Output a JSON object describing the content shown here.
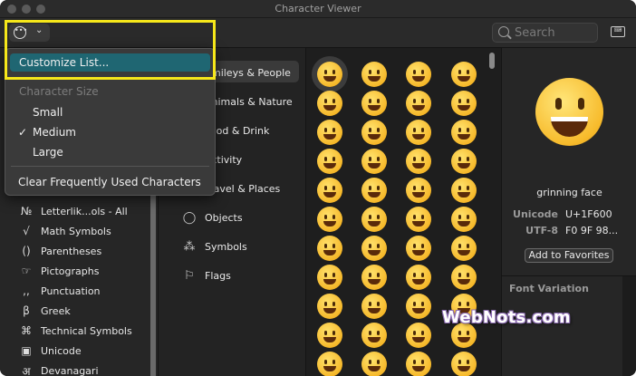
{
  "window": {
    "title": "Character Viewer"
  },
  "toolbar": {
    "menu_button_icon": "ellipsis-circle-icon",
    "search_placeholder": "Search"
  },
  "menu": {
    "customize": "Customize List...",
    "size_header": "Character Size",
    "small": "Small",
    "checkmark": "✓",
    "medium": "Medium",
    "large": "Large",
    "clear": "Clear Frequently Used Characters"
  },
  "sidebar": {
    "items": [
      {
        "icon": "№",
        "label": "Letterlik...ols - All"
      },
      {
        "icon": "√",
        "label": "Math Symbols"
      },
      {
        "icon": "()",
        "label": "Parentheses"
      },
      {
        "icon": "☞",
        "label": "Pictographs"
      },
      {
        "icon": ",,",
        "label": "Punctuation"
      },
      {
        "icon": "β",
        "label": "Greek"
      },
      {
        "icon": "⌘",
        "label": "Technical Symbols"
      },
      {
        "icon": "▣",
        "label": "Unicode"
      },
      {
        "icon": "अ",
        "label": "Devanagari"
      }
    ]
  },
  "categories": {
    "items": [
      {
        "label": "Smileys & People"
      },
      {
        "label": "Animals & Nature"
      },
      {
        "label": "Food & Drink"
      },
      {
        "label": "Activity"
      },
      {
        "label": "Travel & Places"
      },
      {
        "icon": "💡",
        "label": "Objects"
      },
      {
        "icon": "⁂",
        "label": "Symbols"
      },
      {
        "icon": "⚐",
        "label": "Flags"
      }
    ]
  },
  "detail": {
    "name": "grinning face",
    "unicode_label": "Unicode",
    "unicode_value": "U+1F600",
    "utf8_label": "UTF-8",
    "utf8_value": "F0 9F 98...",
    "favorites_button": "Add to Favorites",
    "font_variation": "Font Variation"
  },
  "watermark": "WebNots.com"
}
